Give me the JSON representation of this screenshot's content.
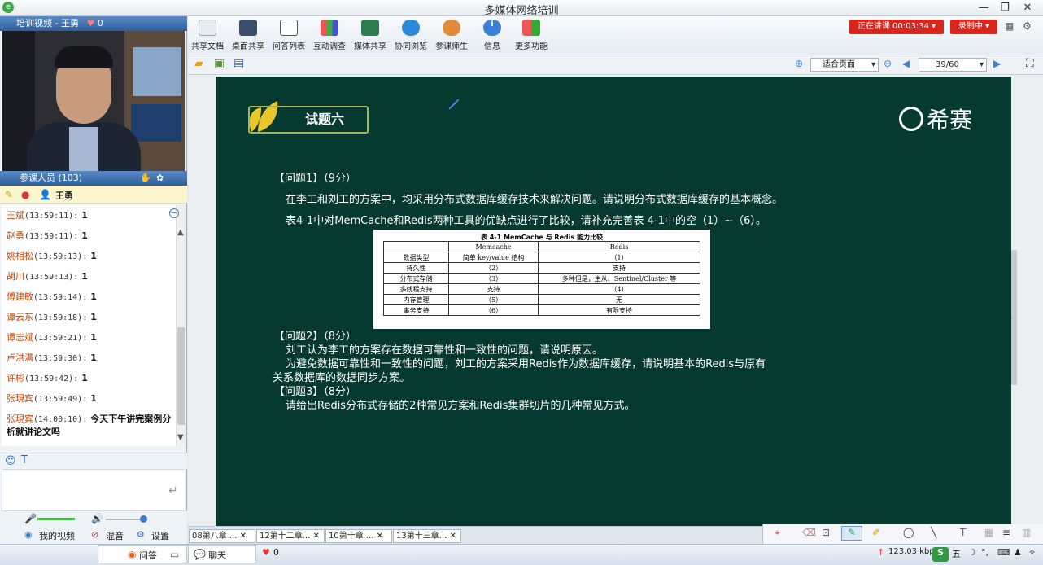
{
  "window": {
    "title": "多媒体网络培训"
  },
  "video_panel": {
    "title": "培训视频 - 王勇",
    "like_count": "0"
  },
  "participants": {
    "title": "参课人员 (103)",
    "current_user": "王勇"
  },
  "chat": {
    "messages": [
      {
        "name": "王斌",
        "time": "(13:59:11):",
        "text": "1"
      },
      {
        "name": "赵勇",
        "time": "(13:59:11):",
        "text": "1"
      },
      {
        "name": "姚相松",
        "time": "(13:59:13):",
        "text": "1"
      },
      {
        "name": "胡川",
        "time": "(13:59:13):",
        "text": "1"
      },
      {
        "name": "傅建敏",
        "time": "(13:59:14):",
        "text": "1"
      },
      {
        "name": "谭云东",
        "time": "(13:59:18):",
        "text": "1"
      },
      {
        "name": "谭志斌",
        "time": "(13:59:21):",
        "text": "1"
      },
      {
        "name": "卢洪满",
        "time": "(13:59:30):",
        "text": "1"
      },
      {
        "name": "许彬",
        "time": "(13:59:42):",
        "text": "1"
      },
      {
        "name": "张現宾",
        "time": "(13:59:49):",
        "text": "1"
      },
      {
        "name": "张現宾",
        "time": "(14:00:10):",
        "text": "今天下午讲完案例分析就讲论文吗"
      }
    ]
  },
  "audio": {
    "my_video": "我的视频",
    "mix": "混音",
    "settings": "设置"
  },
  "toolbar": {
    "tools": [
      "共享文档",
      "桌面共享",
      "问答列表",
      "互动调查",
      "媒体共享",
      "协同浏览",
      "参课师生",
      "信息",
      "更多功能"
    ],
    "live": "正在讲课 00:03:34",
    "record": "录制中"
  },
  "nav": {
    "fit": "适合页面",
    "page": "39/60"
  },
  "slide": {
    "heading": "试题六",
    "brand": "希赛",
    "q1_title": "【问题1】（9分）",
    "q1_l1": "在李工和刘工的方案中，均采用分布式数据库缓存技术来解决问题。请说明分布式数据库缓存的基本概念。",
    "q1_l2": "表4-1中对MemCache和Redis两种工具的优缺点进行了比较，请补充完善表 4-1中的空（1）~（6）。",
    "table": {
      "caption": "表 4-1   MemCache 与 Redis 能力比较",
      "headers": [
        "",
        "Memcache",
        "Redis"
      ],
      "rows": [
        [
          "数据类型",
          "简单 key/value 结构",
          "（1）"
        ],
        [
          "持久性",
          "（2）",
          "支持"
        ],
        [
          "分布式存储",
          "（3）",
          "多种但是，主从、Sentinel/Cluster 等"
        ],
        [
          "多线程支持",
          "支持",
          "（4）"
        ],
        [
          "内存管理",
          "（5）",
          "无"
        ],
        [
          "事务支持",
          "（6）",
          "有限支持"
        ]
      ]
    },
    "q2_title": "【问题2】（8分）",
    "q2_l1": "刘工认为李工的方案存在数据可靠性和一致性的问题，请说明原因。",
    "q2_l2": "为避免数据可靠性和一致性的问题，刘工的方案采用Redis作为数据库缓存，请说明基本的Redis与原有",
    "q2_l3": "关系数据库的数据同步方案。",
    "q3_title": "【问题3】（8分）",
    "q3_l1": "请给出Redis分布式存储的2种常见方案和Redis集群切片的几种常见方式。"
  },
  "tabs": [
    "08第八章 ...",
    "12第十二章...",
    "10第十章 ...",
    "13第十三章..."
  ],
  "status": {
    "qa": "问答",
    "chat": "聊天",
    "likes": "0",
    "speed": "123.03 kbps",
    "ime": "五"
  }
}
